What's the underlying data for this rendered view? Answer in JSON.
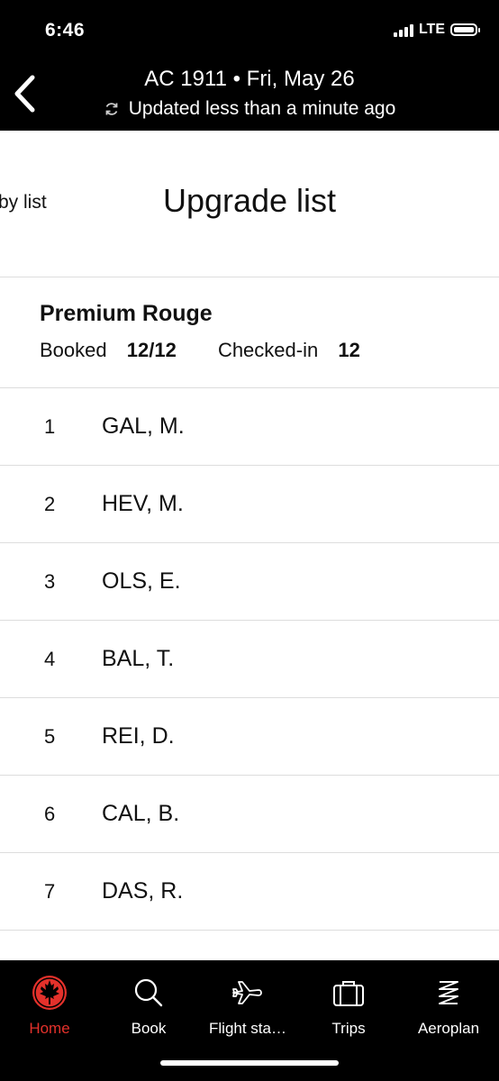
{
  "status_bar": {
    "time": "6:46",
    "network": "LTE"
  },
  "header": {
    "title": "AC 1911 • Fri, May 26",
    "updated": "Updated less than a minute ago"
  },
  "tabs": {
    "previous": "by list",
    "current": "Upgrade list"
  },
  "section": {
    "title": "Premium Rouge",
    "booked_label": "Booked",
    "booked_value": "12/12",
    "checked_label": "Checked-in",
    "checked_value": "12"
  },
  "passengers": [
    {
      "pos": "1",
      "name": "GAL, M."
    },
    {
      "pos": "2",
      "name": "HEV, M."
    },
    {
      "pos": "3",
      "name": "OLS, E."
    },
    {
      "pos": "4",
      "name": "BAL, T."
    },
    {
      "pos": "5",
      "name": "REI, D."
    },
    {
      "pos": "6",
      "name": "CAL, B."
    },
    {
      "pos": "7",
      "name": "DAS, R."
    }
  ],
  "nav": [
    {
      "label": "Home",
      "icon": "maple-leaf-icon",
      "active": true
    },
    {
      "label": "Book",
      "icon": "search-icon",
      "active": false
    },
    {
      "label": "Flight sta…",
      "icon": "airplane-icon",
      "active": false
    },
    {
      "label": "Trips",
      "icon": "briefcase-icon",
      "active": false
    },
    {
      "label": "Aeroplan",
      "icon": "aeroplan-icon",
      "active": false
    }
  ],
  "colors": {
    "accent": "#e4312b",
    "bar": "#000000"
  }
}
